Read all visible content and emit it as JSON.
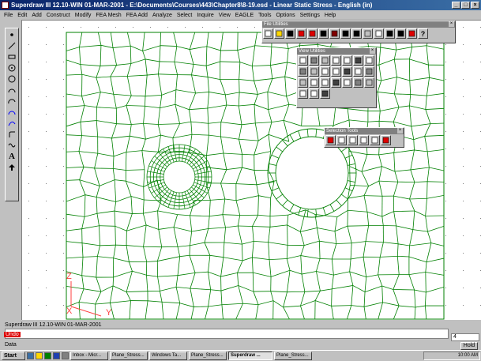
{
  "window": {
    "title": "Superdraw III 12.10-WIN 01-MAR-2001 - E:\\Documents\\Courses\\443\\Chapter8\\8-19.esd - Linear Static Stress - English (in)"
  },
  "menu": [
    "File",
    "Edit",
    "Add",
    "Construct",
    "Modify",
    "FEA Mesh",
    "FEA Add",
    "Analyze",
    "Select",
    "Inquire",
    "View",
    "EAGLE",
    "Tools",
    "Options",
    "Settings",
    "Help"
  ],
  "left_toolbar": {
    "tools": [
      "point-icon",
      "line-icon",
      "rectangle-icon",
      "circle-center-icon",
      "circle-icon",
      "arc-icon",
      "arc-3pt-icon",
      "arc-tangent-icon",
      "spline-icon",
      "fillet-icon",
      "curve-icon",
      "text-icon",
      "arrow-icon"
    ],
    "text_tool_label": "A"
  },
  "palettes": {
    "file_utilities": {
      "title": "File Utilities",
      "buttons": [
        "new-file-icon",
        "open-file-icon",
        "transfer-icon",
        "save-icon",
        "save-as-icon",
        "print-icon",
        "print-preview-icon",
        "plot-icon",
        "cursor-icon",
        "blank-icon",
        "copy-icon",
        "check-icon",
        "help-query-icon",
        "window-icon",
        "help-icon"
      ],
      "help_label": "?"
    },
    "view_utilities": {
      "title": "View Utilities"
    },
    "selection_tools": {
      "title": "Selection Tools"
    }
  },
  "canvas": {
    "axis_labels": {
      "z": "Z",
      "x": "X",
      "y": "Y"
    },
    "mesh_color": "#008000",
    "axis_color": "#ff4040"
  },
  "command": {
    "version_text": "Superdraw III 12.10-WIN 01-MAR-2001",
    "undo_label": "Undo",
    "data_label": "Data",
    "number_value": "4",
    "hold_label": "Hold"
  },
  "taskbar": {
    "start_label": "Start",
    "tasks": [
      "Inbox - Micr...",
      "Plane_Stress...",
      "Windows Ta...",
      "Plane_Stress...",
      "Superdraw ...",
      "Plane_Stress..."
    ],
    "active_task_index": 4,
    "clock": "10:00 AM"
  }
}
